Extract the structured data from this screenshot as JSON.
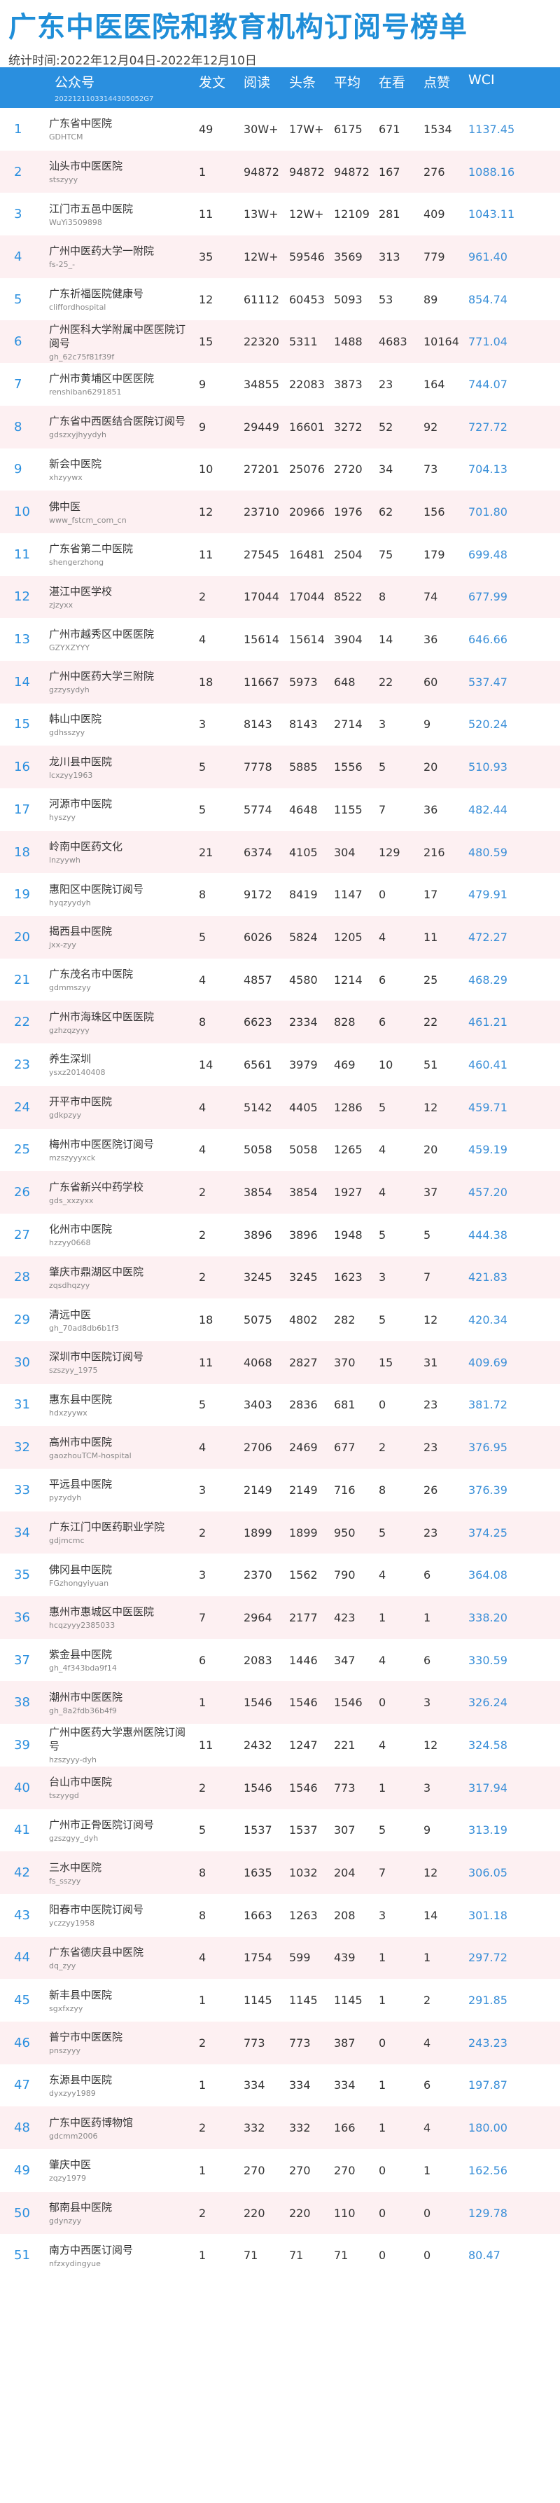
{
  "header": {
    "title": "广东中医医院和教育机构订阅号榜单",
    "period": "统计时间:2022年12月04日-2022年12月10日"
  },
  "table": {
    "columns": {
      "account": "公众号",
      "account_sub": "20221211033144305052G7",
      "posts": "发文",
      "reads": "阅读",
      "headline": "头条",
      "avg": "平均",
      "watching": "在看",
      "likes": "点赞",
      "wci": "WCI"
    },
    "rows": [
      {
        "rank": "1",
        "name": "广东省中医院",
        "id": "GDHTCM",
        "posts": "49",
        "reads": "30W+",
        "headline": "17W+",
        "avg": "6175",
        "watching": "671",
        "likes": "1534",
        "wci": "1137.45"
      },
      {
        "rank": "2",
        "name": "汕头市中医医院",
        "id": "stszyyy",
        "posts": "1",
        "reads": "94872",
        "headline": "94872",
        "avg": "94872",
        "watching": "167",
        "likes": "276",
        "wci": "1088.16"
      },
      {
        "rank": "3",
        "name": "江门市五邑中医院",
        "id": "WuYi3509898",
        "posts": "11",
        "reads": "13W+",
        "headline": "12W+",
        "avg": "12109",
        "watching": "281",
        "likes": "409",
        "wci": "1043.11"
      },
      {
        "rank": "4",
        "name": "广州中医药大学一附院",
        "id": "fs-25_-",
        "posts": "35",
        "reads": "12W+",
        "headline": "59546",
        "avg": "3569",
        "watching": "313",
        "likes": "779",
        "wci": "961.40"
      },
      {
        "rank": "5",
        "name": "广东祈福医院健康号",
        "id": "cliffordhospital",
        "posts": "12",
        "reads": "61112",
        "headline": "60453",
        "avg": "5093",
        "watching": "53",
        "likes": "89",
        "wci": "854.74"
      },
      {
        "rank": "6",
        "name": "广州医科大学附属中医医院订阅号",
        "id": "gh_62c75f81f39f",
        "posts": "15",
        "reads": "22320",
        "headline": "5311",
        "avg": "1488",
        "watching": "4683",
        "likes": "10164",
        "wci": "771.04"
      },
      {
        "rank": "7",
        "name": "广州市黄埔区中医医院",
        "id": "renshiban6291851",
        "posts": "9",
        "reads": "34855",
        "headline": "22083",
        "avg": "3873",
        "watching": "23",
        "likes": "164",
        "wci": "744.07"
      },
      {
        "rank": "8",
        "name": "广东省中西医结合医院订阅号",
        "id": "gdszxyjhyydyh",
        "posts": "9",
        "reads": "29449",
        "headline": "16601",
        "avg": "3272",
        "watching": "52",
        "likes": "92",
        "wci": "727.72"
      },
      {
        "rank": "9",
        "name": "新会中医院",
        "id": "xhzyywx",
        "posts": "10",
        "reads": "27201",
        "headline": "25076",
        "avg": "2720",
        "watching": "34",
        "likes": "73",
        "wci": "704.13"
      },
      {
        "rank": "10",
        "name": "佛中医",
        "id": "www_fstcm_com_cn",
        "posts": "12",
        "reads": "23710",
        "headline": "20966",
        "avg": "1976",
        "watching": "62",
        "likes": "156",
        "wci": "701.80"
      },
      {
        "rank": "11",
        "name": "广东省第二中医院",
        "id": "shengerzhong",
        "posts": "11",
        "reads": "27545",
        "headline": "16481",
        "avg": "2504",
        "watching": "75",
        "likes": "179",
        "wci": "699.48"
      },
      {
        "rank": "12",
        "name": "湛江中医学校",
        "id": "zjzyxx",
        "posts": "2",
        "reads": "17044",
        "headline": "17044",
        "avg": "8522",
        "watching": "8",
        "likes": "74",
        "wci": "677.99"
      },
      {
        "rank": "13",
        "name": "广州市越秀区中医医院",
        "id": "GZYXZYYY",
        "posts": "4",
        "reads": "15614",
        "headline": "15614",
        "avg": "3904",
        "watching": "14",
        "likes": "36",
        "wci": "646.66"
      },
      {
        "rank": "14",
        "name": "广州中医药大学三附院",
        "id": "gzzysydyh",
        "posts": "18",
        "reads": "11667",
        "headline": "5973",
        "avg": "648",
        "watching": "22",
        "likes": "60",
        "wci": "537.47"
      },
      {
        "rank": "15",
        "name": "韩山中医院",
        "id": "gdhsszyy",
        "posts": "3",
        "reads": "8143",
        "headline": "8143",
        "avg": "2714",
        "watching": "3",
        "likes": "9",
        "wci": "520.24"
      },
      {
        "rank": "16",
        "name": "龙川县中医院",
        "id": "lcxzyy1963",
        "posts": "5",
        "reads": "7778",
        "headline": "5885",
        "avg": "1556",
        "watching": "5",
        "likes": "20",
        "wci": "510.93"
      },
      {
        "rank": "17",
        "name": "河源市中医院",
        "id": "hyszyy",
        "posts": "5",
        "reads": "5774",
        "headline": "4648",
        "avg": "1155",
        "watching": "7",
        "likes": "36",
        "wci": "482.44"
      },
      {
        "rank": "18",
        "name": "岭南中医药文化",
        "id": "lnzyywh",
        "posts": "21",
        "reads": "6374",
        "headline": "4105",
        "avg": "304",
        "watching": "129",
        "likes": "216",
        "wci": "480.59"
      },
      {
        "rank": "19",
        "name": "惠阳区中医院订阅号",
        "id": "hyqzyydyh",
        "posts": "8",
        "reads": "9172",
        "headline": "8419",
        "avg": "1147",
        "watching": "0",
        "likes": "17",
        "wci": "479.91"
      },
      {
        "rank": "20",
        "name": "揭西县中医院",
        "id": "jxx-zyy",
        "posts": "5",
        "reads": "6026",
        "headline": "5824",
        "avg": "1205",
        "watching": "4",
        "likes": "11",
        "wci": "472.27"
      },
      {
        "rank": "21",
        "name": "广东茂名市中医院",
        "id": "gdmmszyy",
        "posts": "4",
        "reads": "4857",
        "headline": "4580",
        "avg": "1214",
        "watching": "6",
        "likes": "25",
        "wci": "468.29"
      },
      {
        "rank": "22",
        "name": "广州市海珠区中医医院",
        "id": "gzhzqzyyy",
        "posts": "8",
        "reads": "6623",
        "headline": "2334",
        "avg": "828",
        "watching": "6",
        "likes": "22",
        "wci": "461.21"
      },
      {
        "rank": "23",
        "name": "养生深圳",
        "id": "ysxz20140408",
        "posts": "14",
        "reads": "6561",
        "headline": "3979",
        "avg": "469",
        "watching": "10",
        "likes": "51",
        "wci": "460.41"
      },
      {
        "rank": "24",
        "name": "开平市中医院",
        "id": "gdkpzyy",
        "posts": "4",
        "reads": "5142",
        "headline": "4405",
        "avg": "1286",
        "watching": "5",
        "likes": "12",
        "wci": "459.71"
      },
      {
        "rank": "25",
        "name": "梅州市中医医院订阅号",
        "id": "mzszyyyxck",
        "posts": "4",
        "reads": "5058",
        "headline": "5058",
        "avg": "1265",
        "watching": "4",
        "likes": "20",
        "wci": "459.19"
      },
      {
        "rank": "26",
        "name": "广东省新兴中药学校",
        "id": "gds_xxzyxx",
        "posts": "2",
        "reads": "3854",
        "headline": "3854",
        "avg": "1927",
        "watching": "4",
        "likes": "37",
        "wci": "457.20"
      },
      {
        "rank": "27",
        "name": "化州市中医院",
        "id": "hzzyy0668",
        "posts": "2",
        "reads": "3896",
        "headline": "3896",
        "avg": "1948",
        "watching": "5",
        "likes": "5",
        "wci": "444.38"
      },
      {
        "rank": "28",
        "name": "肇庆市鼎湖区中医院",
        "id": "zqsdhqzyy",
        "posts": "2",
        "reads": "3245",
        "headline": "3245",
        "avg": "1623",
        "watching": "3",
        "likes": "7",
        "wci": "421.83"
      },
      {
        "rank": "29",
        "name": "清远中医",
        "id": "gh_70ad8db6b1f3",
        "posts": "18",
        "reads": "5075",
        "headline": "4802",
        "avg": "282",
        "watching": "5",
        "likes": "12",
        "wci": "420.34"
      },
      {
        "rank": "30",
        "name": "深圳市中医院订阅号",
        "id": "szszyy_1975",
        "posts": "11",
        "reads": "4068",
        "headline": "2827",
        "avg": "370",
        "watching": "15",
        "likes": "31",
        "wci": "409.69"
      },
      {
        "rank": "31",
        "name": "惠东县中医院",
        "id": "hdxzyywx",
        "posts": "5",
        "reads": "3403",
        "headline": "2836",
        "avg": "681",
        "watching": "0",
        "likes": "23",
        "wci": "381.72"
      },
      {
        "rank": "32",
        "name": "高州市中医院",
        "id": "gaozhouTCM-hospital",
        "posts": "4",
        "reads": "2706",
        "headline": "2469",
        "avg": "677",
        "watching": "2",
        "likes": "23",
        "wci": "376.95"
      },
      {
        "rank": "33",
        "name": "平远县中医院",
        "id": "pyzydyh",
        "posts": "3",
        "reads": "2149",
        "headline": "2149",
        "avg": "716",
        "watching": "8",
        "likes": "26",
        "wci": "376.39"
      },
      {
        "rank": "34",
        "name": "广东江门中医药职业学院",
        "id": "gdjmcmc",
        "posts": "2",
        "reads": "1899",
        "headline": "1899",
        "avg": "950",
        "watching": "5",
        "likes": "23",
        "wci": "374.25"
      },
      {
        "rank": "35",
        "name": "佛冈县中医院",
        "id": "FGzhongyiyuan",
        "posts": "3",
        "reads": "2370",
        "headline": "1562",
        "avg": "790",
        "watching": "4",
        "likes": "6",
        "wci": "364.08"
      },
      {
        "rank": "36",
        "name": "惠州市惠城区中医医院",
        "id": "hcqzyyy2385033",
        "posts": "7",
        "reads": "2964",
        "headline": "2177",
        "avg": "423",
        "watching": "1",
        "likes": "1",
        "wci": "338.20"
      },
      {
        "rank": "37",
        "name": "紫金县中医院",
        "id": "gh_4f343bda9f14",
        "posts": "6",
        "reads": "2083",
        "headline": "1446",
        "avg": "347",
        "watching": "4",
        "likes": "6",
        "wci": "330.59"
      },
      {
        "rank": "38",
        "name": "潮州市中医医院",
        "id": "gh_8a2fdb36b4f9",
        "posts": "1",
        "reads": "1546",
        "headline": "1546",
        "avg": "1546",
        "watching": "0",
        "likes": "3",
        "wci": "326.24"
      },
      {
        "rank": "39",
        "name": "广州中医药大学惠州医院订阅号",
        "id": "hzszyyy-dyh",
        "posts": "11",
        "reads": "2432",
        "headline": "1247",
        "avg": "221",
        "watching": "4",
        "likes": "12",
        "wci": "324.58"
      },
      {
        "rank": "40",
        "name": "台山市中医院",
        "id": "tszyygd",
        "posts": "2",
        "reads": "1546",
        "headline": "1546",
        "avg": "773",
        "watching": "1",
        "likes": "3",
        "wci": "317.94"
      },
      {
        "rank": "41",
        "name": "广州市正骨医院订阅号",
        "id": "gzszgyy_dyh",
        "posts": "5",
        "reads": "1537",
        "headline": "1537",
        "avg": "307",
        "watching": "5",
        "likes": "9",
        "wci": "313.19"
      },
      {
        "rank": "42",
        "name": "三水中医院",
        "id": "fs_sszyy",
        "posts": "8",
        "reads": "1635",
        "headline": "1032",
        "avg": "204",
        "watching": "7",
        "likes": "12",
        "wci": "306.05"
      },
      {
        "rank": "43",
        "name": "阳春市中医院订阅号",
        "id": "yczzyy1958",
        "posts": "8",
        "reads": "1663",
        "headline": "1263",
        "avg": "208",
        "watching": "3",
        "likes": "14",
        "wci": "301.18"
      },
      {
        "rank": "44",
        "name": "广东省德庆县中医院",
        "id": "dq_zyy",
        "posts": "4",
        "reads": "1754",
        "headline": "599",
        "avg": "439",
        "watching": "1",
        "likes": "1",
        "wci": "297.72"
      },
      {
        "rank": "45",
        "name": "新丰县中医院",
        "id": "sgxfxzyy",
        "posts": "1",
        "reads": "1145",
        "headline": "1145",
        "avg": "1145",
        "watching": "1",
        "likes": "2",
        "wci": "291.85"
      },
      {
        "rank": "46",
        "name": "普宁市中医医院",
        "id": "pnszyyy",
        "posts": "2",
        "reads": "773",
        "headline": "773",
        "avg": "387",
        "watching": "0",
        "likes": "4",
        "wci": "243.23"
      },
      {
        "rank": "47",
        "name": "东源县中医院",
        "id": "dyxzyy1989",
        "posts": "1",
        "reads": "334",
        "headline": "334",
        "avg": "334",
        "watching": "1",
        "likes": "6",
        "wci": "197.87"
      },
      {
        "rank": "48",
        "name": "广东中医药博物馆",
        "id": "gdcmm2006",
        "posts": "2",
        "reads": "332",
        "headline": "332",
        "avg": "166",
        "watching": "1",
        "likes": "4",
        "wci": "180.00"
      },
      {
        "rank": "49",
        "name": "肇庆中医",
        "id": "zqzy1979",
        "posts": "1",
        "reads": "270",
        "headline": "270",
        "avg": "270",
        "watching": "0",
        "likes": "1",
        "wci": "162.56"
      },
      {
        "rank": "50",
        "name": "郁南县中医院",
        "id": "gdynzyy",
        "posts": "2",
        "reads": "220",
        "headline": "220",
        "avg": "110",
        "watching": "0",
        "likes": "0",
        "wci": "129.78"
      },
      {
        "rank": "51",
        "name": "南方中西医订阅号",
        "id": "nfzxydingyue",
        "posts": "1",
        "reads": "71",
        "headline": "71",
        "avg": "71",
        "watching": "0",
        "likes": "0",
        "wci": "80.47"
      }
    ]
  }
}
